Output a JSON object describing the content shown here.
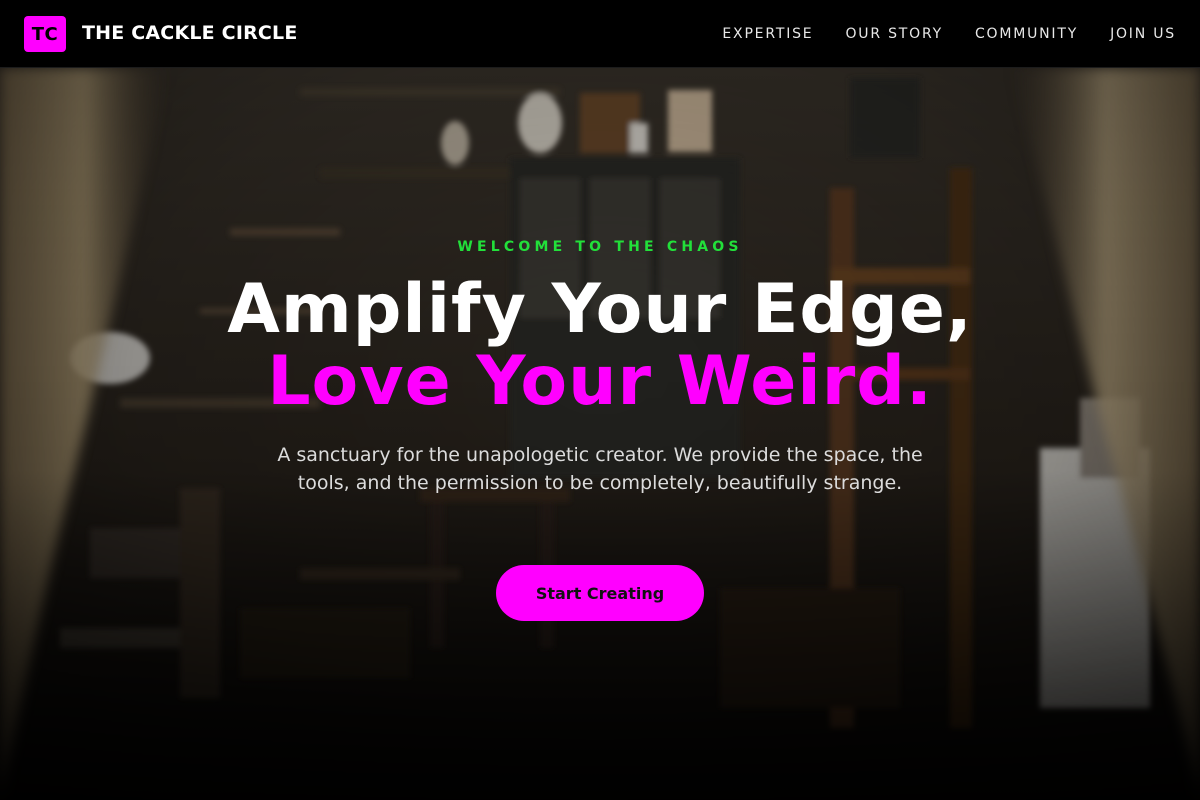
{
  "brand": {
    "badge": "TC",
    "name": "THE CACKLE CIRCLE",
    "accent": "#ff00ff"
  },
  "nav": {
    "links": [
      "EXPERTISE",
      "OUR STORY",
      "COMMUNITY",
      "JOIN US"
    ]
  },
  "hero": {
    "eyebrow": "WELCOME TO THE CHAOS",
    "eyebrow_color": "#22e03a",
    "headline_line1": "Amplify Your Edge,",
    "headline_line2": "Love Your Weird.",
    "subtitle": "A sanctuary for the unapologetic creator. We provide the space, the tools, and the permission to be completely, beautifully strange.",
    "cta_label": "Start Creating",
    "background": "cluttered-workshop-photo"
  }
}
